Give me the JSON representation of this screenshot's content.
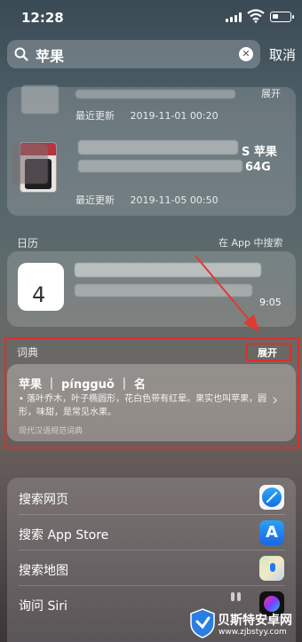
{
  "status_bar": {
    "time": "12:28"
  },
  "search": {
    "query": "苹果",
    "cancel_label": "取消"
  },
  "app_store_results": {
    "expand_label": "展开",
    "items": [
      {
        "updated_label": "最近更新",
        "updated_date": "2019-11-01 00:20"
      },
      {
        "title_visible": "S 苹果",
        "subtitle_visible": "64G",
        "updated_label": "最近更新",
        "updated_date": "2019-11-05 00:50"
      }
    ]
  },
  "calendar_section": {
    "label": "日历",
    "search_in_app_label": "在 App 中搜索",
    "icon_day": "4",
    "event_time": "9:05"
  },
  "dictionary_section": {
    "label": "词典",
    "expand_label": "展开",
    "headword": "苹果 ｜ píngguǒ ｜ 名",
    "definition": "• 落叶乔木，叶子椭圆形，花白色带有红晕。果实也叫苹果，圆形，味甜，是常见水果。",
    "source": "现代汉语规范词典"
  },
  "search_actions": [
    {
      "label": "搜索网页",
      "icon": "safari-icon"
    },
    {
      "label": "搜索 App Store",
      "icon": "app-store-icon"
    },
    {
      "label": "搜索地图",
      "icon": "maps-icon"
    },
    {
      "label": "询问 Siri",
      "icon": "siri-icon"
    }
  ],
  "watermark": {
    "title": "贝斯特安卓网",
    "url": "www.zjbstyy.com"
  },
  "colors": {
    "highlight_red": "#d9302c"
  }
}
